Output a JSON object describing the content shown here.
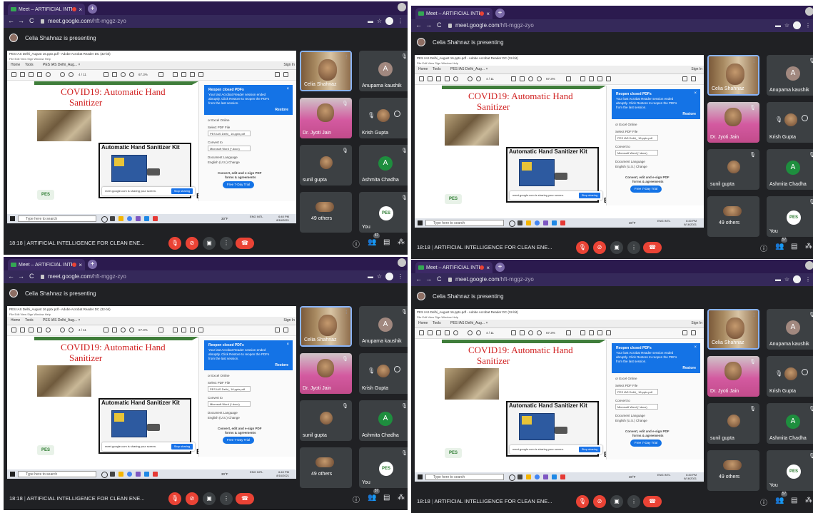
{
  "browser": {
    "tab_title": "Meet – ARTIFICIAL INTELL",
    "tab_close": "×",
    "new_tab": "+",
    "back": "←",
    "forward": "→",
    "reload": "C",
    "url_host": "meet.google.com",
    "url_path": "/hft-mggz-zyo",
    "star": "☆"
  },
  "presentation": {
    "presenter_text": "Celia Shahnaz is presenting"
  },
  "acrobat": {
    "window_title": "PES IAS Delhi_August 16.pptx.pdf - Adobe Acrobat Reader DC (32-bit)",
    "menu": "File  Edit  View  Sign  Window  Help",
    "tab_home": "Home",
    "tab_tools": "Tools",
    "tab_doc": "PES IAS Delhi_Aug... ×",
    "sign_in": "Sign In",
    "page_indicator": "4 / 11",
    "zoom": "67.3%"
  },
  "slide": {
    "title_line1": "COVID19: Automatic Hand",
    "title_line2": "Sanitizer",
    "kit_title": "Automatic Hand Sanitizer Kit",
    "logo": "PES",
    "ee": "EE"
  },
  "popup": {
    "title": "Reopen closed PDFs",
    "body": "Your last Acrobat Reader session ended abruptly. Click Restore to reopen the PDFs from the last session.",
    "restore": "Restore",
    "close": "×"
  },
  "right_panel": {
    "or_excel": "or Excel Online",
    "select_pdf_label": "Select PDF File",
    "pdf_file": "PES IAS Delhi_ 16.pptx.pdf",
    "convert_label": "Convert to",
    "convert_value": "Microsoft Word (*.docx)",
    "doc_lang_label": "Document Language",
    "doc_lang_value": "English (U.S.)  Change",
    "promo_line1": "Convert, edit and e-sign PDF",
    "promo_line2": "forms & agreements",
    "trial_button": "Free 7-Day Trial"
  },
  "share_bar": {
    "text": "meet.google.com is sharing your screen.",
    "stop": "Stop sharing"
  },
  "taskbar": {
    "search": "Type here to search",
    "weather": "30°F",
    "time": "6:40 PM",
    "date": "8/16/2021",
    "lang": "ENG INTL"
  },
  "participants": [
    {
      "name": "Celia Shahnaz",
      "kind": "video",
      "active": true
    },
    {
      "name": "Anupama kaushik",
      "kind": "letter",
      "letter": "A",
      "color": "#a1887f"
    },
    {
      "name": "Dr. Jyoti Jain",
      "kind": "video"
    },
    {
      "name": "Krish Gupta",
      "kind": "photo"
    },
    {
      "name": "sunil gupta",
      "kind": "photo"
    },
    {
      "name": "Ashmita Chadha",
      "kind": "letter",
      "letter": "A",
      "color": "#1e8e3e"
    },
    {
      "name": "49 others",
      "kind": "photo"
    },
    {
      "name": "You",
      "kind": "logo"
    }
  ],
  "bottom": {
    "time": "18:18",
    "separator": "|",
    "meeting_name": "ARTIFICIAL INTELLIGENCE FOR CLEAN ENE...",
    "participant_count": "57"
  },
  "icons": {
    "mic": "mic-off-icon",
    "cam": "camera-off-icon",
    "present": "present-icon",
    "more": "more-vert-icon",
    "end": "end-call-icon",
    "info": "info-icon",
    "people": "people-icon",
    "chat": "chat-icon",
    "activities": "activities-icon"
  },
  "colors": {
    "meet_bg": "#202124",
    "tile_bg": "#3c4043",
    "end_call": "#ea4335",
    "acrobat_blue": "#1473e6",
    "slide_title": "#d02020",
    "tab_bar": "#2b1a4e"
  }
}
